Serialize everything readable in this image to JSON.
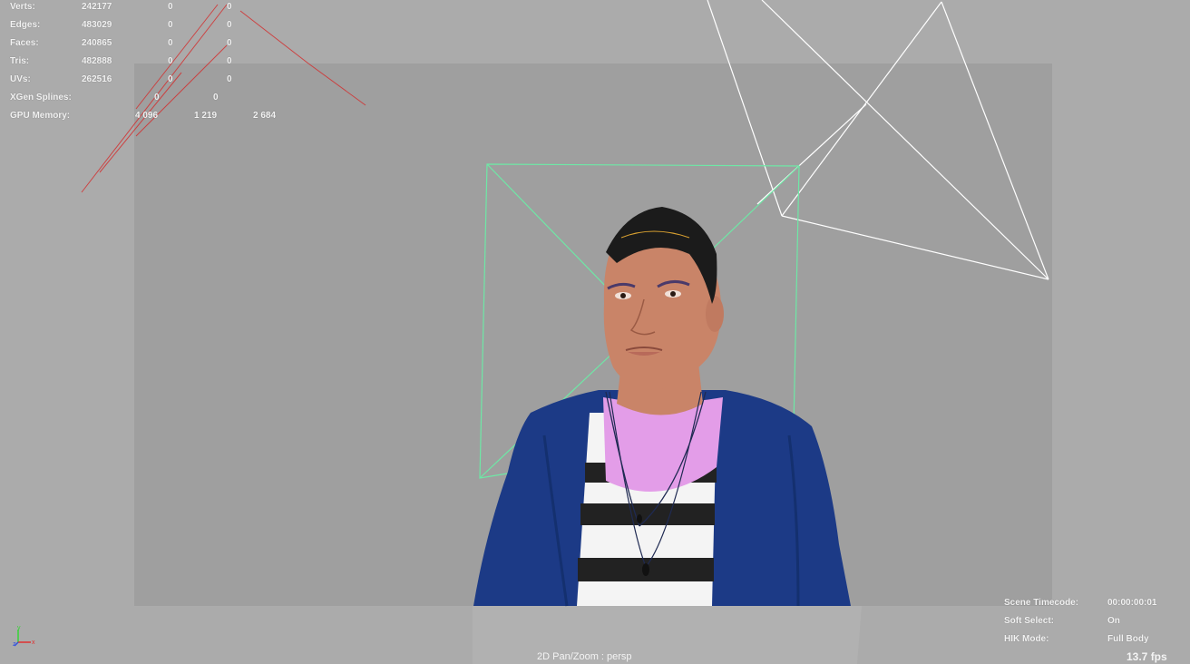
{
  "poly_count": {
    "rows": [
      {
        "label": "Verts:",
        "values": [
          "242177",
          "0",
          "0"
        ]
      },
      {
        "label": "Edges:",
        "values": [
          "483029",
          "0",
          "0"
        ]
      },
      {
        "label": "Faces:",
        "values": [
          "240865",
          "0",
          "0"
        ]
      },
      {
        "label": "Tris:",
        "values": [
          "482888",
          "0",
          "0"
        ]
      },
      {
        "label": "UVs:",
        "values": [
          "262516",
          "0",
          "0"
        ]
      },
      {
        "label": "XGen Splines:",
        "values": [
          "0",
          "0"
        ]
      },
      {
        "label": "GPU Memory:",
        "values": [
          "4 096",
          "1 219",
          "2 684"
        ]
      }
    ]
  },
  "status": {
    "rows": [
      {
        "label": "Scene Timecode:",
        "value": "00:00:00:01"
      },
      {
        "label": "Soft Select:",
        "value": "On"
      },
      {
        "label": "HIK Mode:",
        "value": "Full Body"
      }
    ],
    "fps": "13.7 fps"
  },
  "camera_label": "2D Pan/Zoom : persp",
  "axis": {
    "y": "y",
    "x": "x",
    "z": "z"
  },
  "colors": {
    "background": "#ababab",
    "resolution_gate": "#9f9f9f",
    "light_gizmo": "#6ee8a6",
    "camera_gizmo": "#ffffff",
    "red_lines": "#d23030",
    "jacket": "#1c3a86",
    "shirt_pink": "#e39de8"
  }
}
